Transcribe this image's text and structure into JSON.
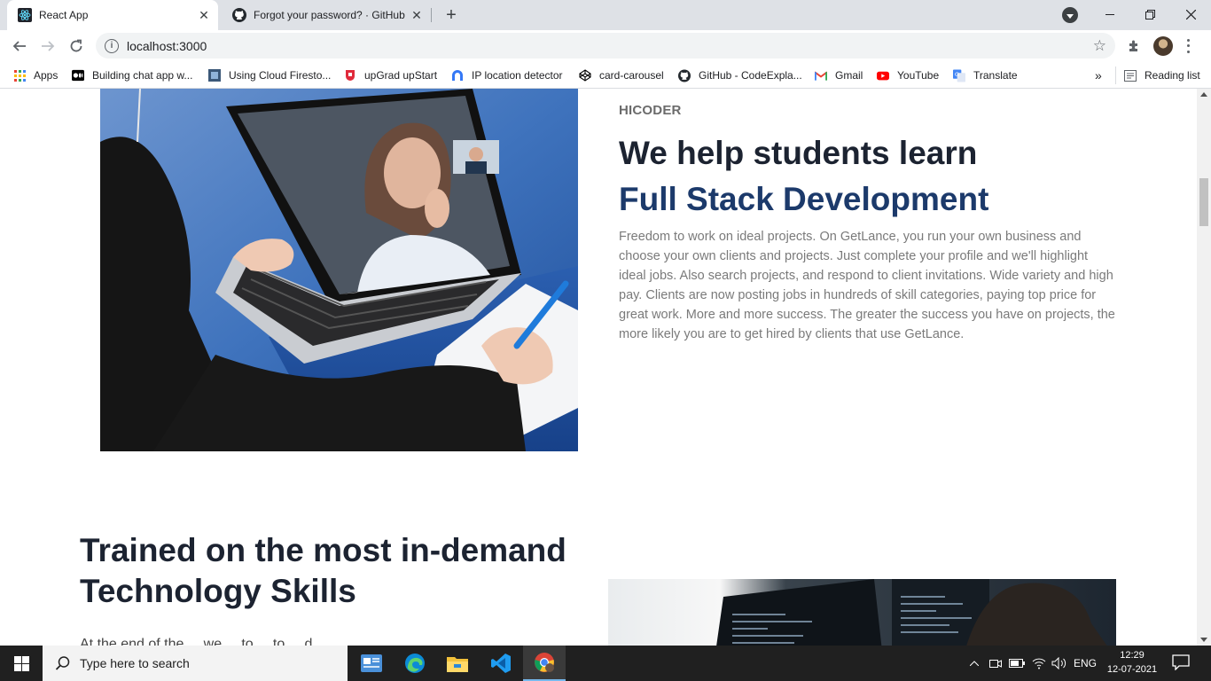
{
  "browser": {
    "tabs": [
      {
        "title": "React App",
        "active": true,
        "icon": "react-icon"
      },
      {
        "title": "Forgot your password? · GitHub",
        "active": false,
        "icon": "github-icon"
      }
    ],
    "url": "localhost:3000",
    "bookmarks": [
      {
        "label": "Apps",
        "icon": "apps-grid-icon"
      },
      {
        "label": "Building chat app w...",
        "icon": "medium-icon"
      },
      {
        "label": "Using Cloud Firesto...",
        "icon": "book-icon"
      },
      {
        "label": "upGrad upStart",
        "icon": "upgrad-icon"
      },
      {
        "label": "IP location detector",
        "icon": "location-icon"
      },
      {
        "label": "card-carousel",
        "icon": "codepen-icon"
      },
      {
        "label": "GitHub - CodeExpla...",
        "icon": "github-icon"
      },
      {
        "label": "Gmail",
        "icon": "gmail-icon"
      },
      {
        "label": "YouTube",
        "icon": "youtube-icon"
      },
      {
        "label": "Translate",
        "icon": "translate-icon"
      }
    ],
    "reading_list": "Reading list",
    "overflow": "»"
  },
  "page": {
    "eyebrow": "HICODER",
    "headline_line1": "We help students learn",
    "headline_line2": "Full Stack Development",
    "body": "Freedom to work on ideal projects. On GetLance, you run your own business and choose your own clients and projects. Just complete your profile and we'll highlight ideal jobs. Also search projects, and respond to client invitations. Wide variety and high pay. Clients are now posting jobs in hundreds of skill categories, paying top price for great work. More and more success. The greater the success you have on projects, the more likely you are to get hired by clients that use GetLance.",
    "section2_title_line1": "Trained on the most in-demand",
    "section2_title_line2": "Technology Skills",
    "section2_body_partial": "At the end of the ... we ... to ... to ... d ...",
    "colors": {
      "headline_dark": "#1c2331",
      "headline_accent": "#1c3a6b",
      "body_text": "#7a7a7a"
    }
  },
  "taskbar": {
    "search_placeholder": "Type here to search",
    "language": "ENG",
    "time": "12:29",
    "date": "12-07-2021"
  }
}
